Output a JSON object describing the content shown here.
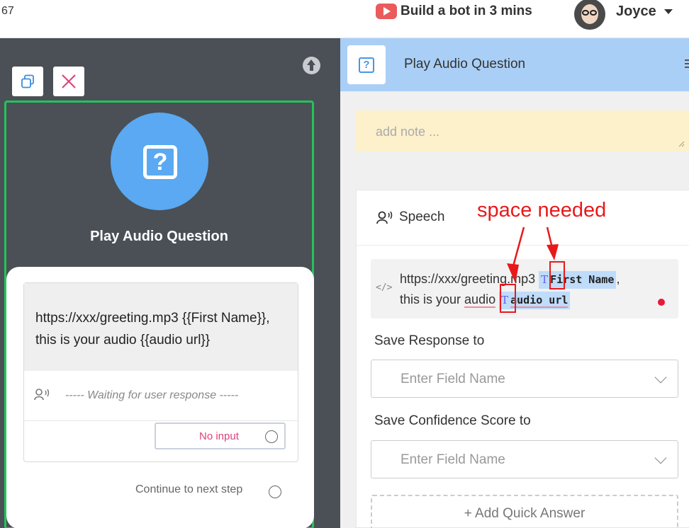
{
  "topbar": {
    "left_number": "67",
    "promo_label": "Build a bot in 3 mins",
    "user_name": "Joyce"
  },
  "left_panel": {
    "node_title": "Play Audio Question",
    "message_line1": "https://xxx/greeting.mp3 {{First Name}},",
    "message_line2": "this is your audio {{audio url}}",
    "waiting_text": "----- Waiting for user response -----",
    "no_input_label": "No input",
    "continue_label": "Continue to next step"
  },
  "right_panel": {
    "header_title": "Play Audio Question",
    "note_placeholder": "add note ...",
    "speech_tab": "Speech",
    "editor": {
      "line1_text": "https://xxx/greeting.mp3",
      "var1": "First Name",
      "line1_suffix": ",",
      "line2_prefix": "this is your",
      "line2_word": "audio",
      "var2": "audio url"
    },
    "save_response_label": "Save Response to",
    "save_response_placeholder": "Enter Field Name",
    "save_confidence_label": "Save Confidence Score to",
    "save_confidence_placeholder": "Enter Field Name",
    "add_quick_answer": "+ Add Quick Answer"
  },
  "annotation": {
    "text": "space needed",
    "color": "#e8191b"
  },
  "colors": {
    "node_accent": "#5aa9f2",
    "selection_border": "#24c35a",
    "header_bg": "#aacff6",
    "note_bg": "#fdf1cc",
    "no_input_text": "#e0407a"
  }
}
